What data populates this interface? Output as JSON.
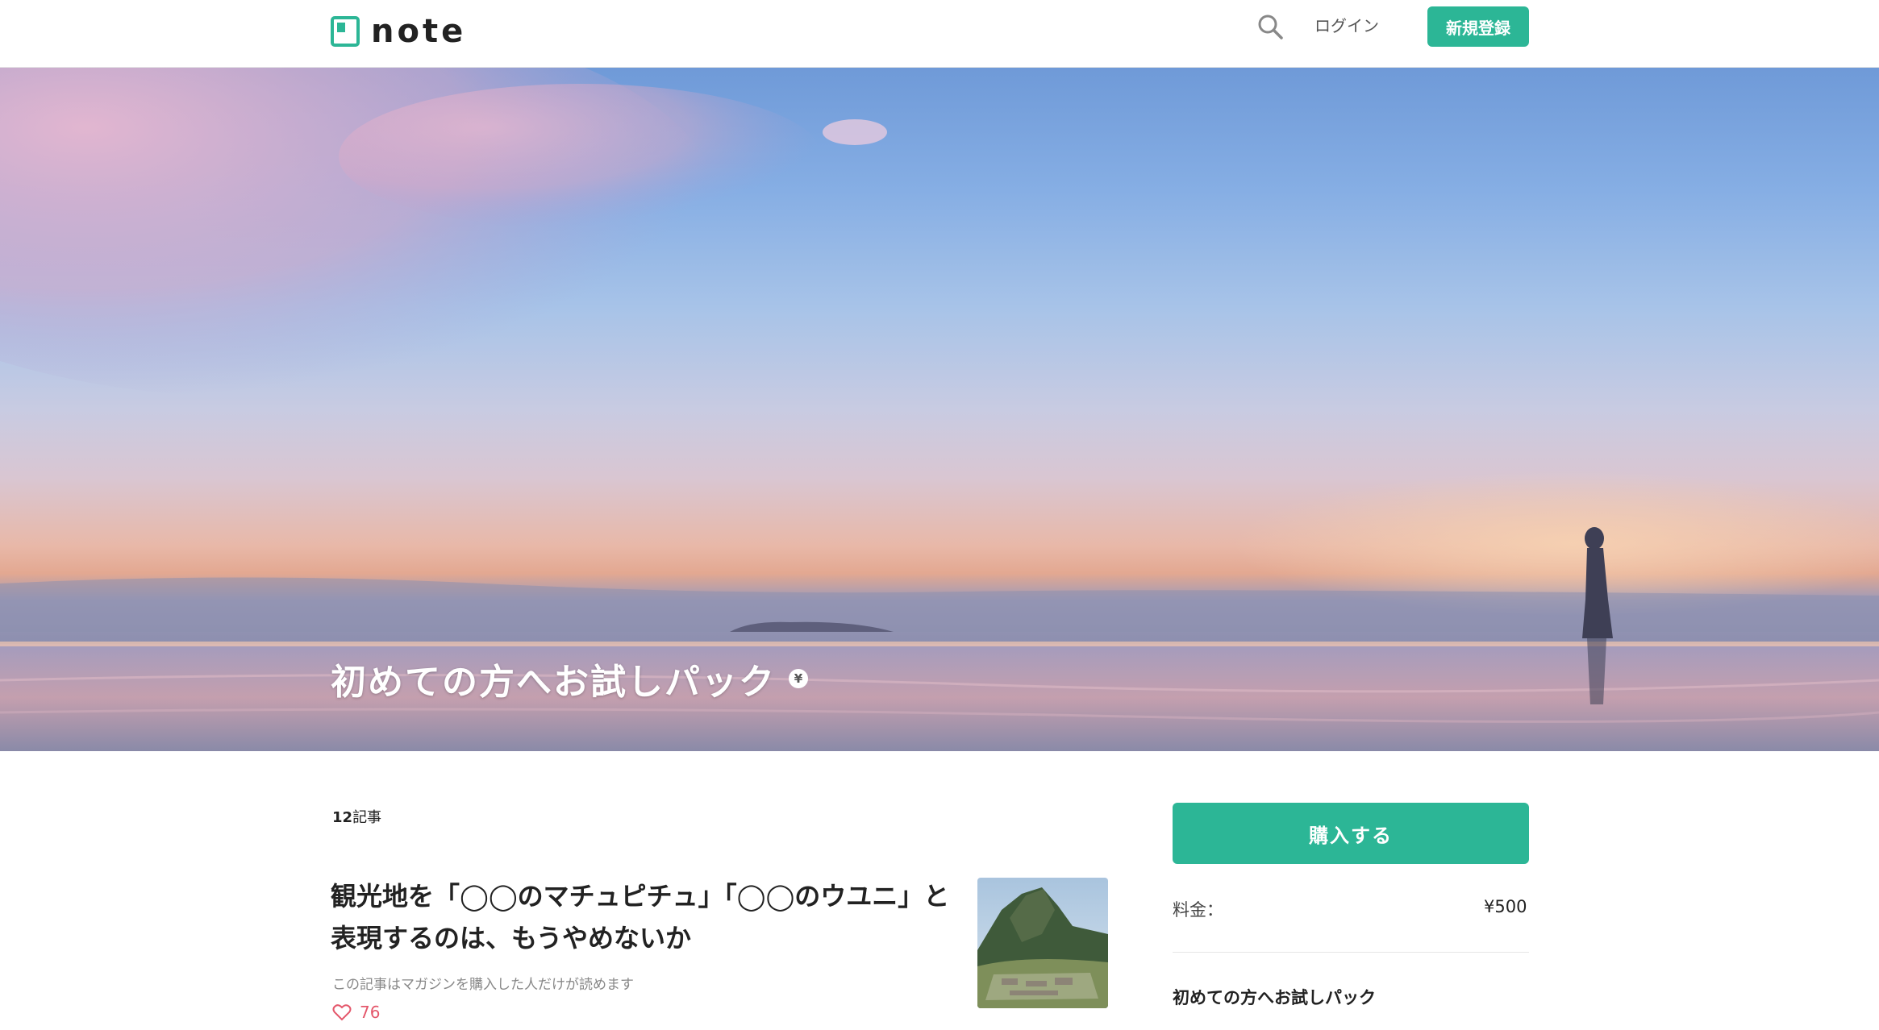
{
  "header": {
    "logo_text": "note",
    "login_label": "ログイン",
    "signup_label": "新規登録"
  },
  "hero": {
    "title": "初めての方へお試しパック",
    "yen_badge": "¥"
  },
  "main": {
    "article_count_number": "12",
    "article_count_unit": "記事",
    "article": {
      "title": "観光地を「◯◯のマチュピチュ」「◯◯のウユニ」と表現するのは、もうやめないか",
      "note": "この記事はマガジンを購入した人だけが読めます",
      "likes": "76"
    }
  },
  "sidebar": {
    "buy_label": "購入する",
    "price_label": "料金：",
    "price_value": "¥500",
    "magazine_name": "初めての方へお試しパック"
  },
  "colors": {
    "brand": "#2cb696",
    "like": "#e4576b"
  },
  "icons": {
    "search": "search-icon",
    "like": "heart-icon",
    "logo": "note-logo-icon"
  }
}
